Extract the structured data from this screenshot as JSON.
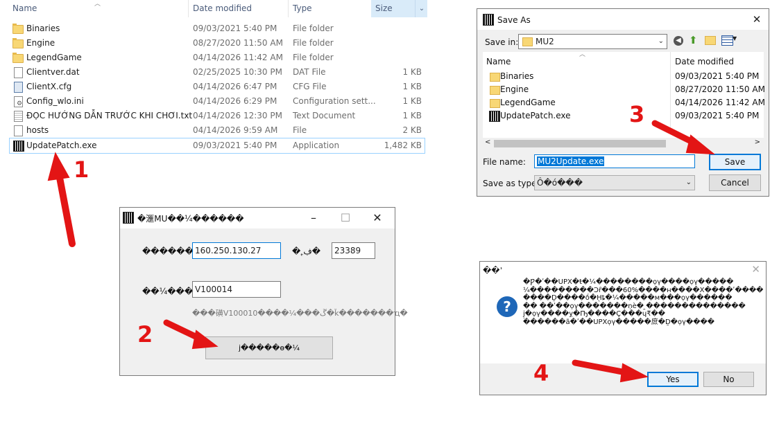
{
  "explorer": {
    "columns": {
      "name": "Name",
      "date": "Date modified",
      "type": "Type",
      "size": "Size"
    },
    "files": [
      {
        "name": "Binaries",
        "date": "09/03/2021 5:40 PM",
        "type": "File folder",
        "size": "",
        "icon": "folder-icon"
      },
      {
        "name": "Engine",
        "date": "08/27/2020 11:50 AM",
        "type": "File folder",
        "size": "",
        "icon": "folder-icon"
      },
      {
        "name": "LegendGame",
        "date": "04/14/2026 11:42 AM",
        "type": "File folder",
        "size": "",
        "icon": "folder-icon"
      },
      {
        "name": "Clientver.dat",
        "date": "02/25/2025 10:30 PM",
        "type": "DAT File",
        "size": "1 KB",
        "icon": "file-icon"
      },
      {
        "name": "ClientX.cfg",
        "date": "04/14/2026 6:47 PM",
        "type": "CFG File",
        "size": "1 KB",
        "icon": "config-file-icon"
      },
      {
        "name": "Config_wlo.ini",
        "date": "04/14/2026 6:29 PM",
        "type": "Configuration sett...",
        "size": "1 KB",
        "icon": "settings-file-icon"
      },
      {
        "name": "ĐỌC HƯỚNG DẪN TRƯỚC KHI CHƠI.txt",
        "date": "04/14/2026 12:30 PM",
        "type": "Text Document",
        "size": "1 KB",
        "icon": "text-file-icon"
      },
      {
        "name": "hosts",
        "date": "04/14/2026 9:59 AM",
        "type": "File",
        "size": "2 KB",
        "icon": "file-icon"
      },
      {
        "name": "UpdatePatch.exe",
        "date": "09/03/2021 5:40 PM",
        "type": "Application",
        "size": "1,482 KB",
        "icon": "exe-icon"
      }
    ]
  },
  "launcher": {
    "title": "�滙MU��¼������",
    "ip_label": "������IP��",
    "ip_value": "160.250.130.27",
    "port_label": "�˿ڣ�",
    "port_value": "23389",
    "version_label": "��¼���汾�",
    "version_value": "V100014",
    "hint": "���磺V100010����¼���ڱ�ǩ�������ҵ�",
    "button_label": "j�����ɵ�¼"
  },
  "save_as": {
    "title": "Save As",
    "save_in_label": "Save in:",
    "save_in_value": "MU2",
    "columns": {
      "name": "Name",
      "date": "Date modified"
    },
    "files": [
      {
        "name": "Binaries",
        "date": "09/03/2021 5:40 PM",
        "icon": "folder-icon"
      },
      {
        "name": "Engine",
        "date": "08/27/2020 11:50 AM",
        "icon": "folder-icon"
      },
      {
        "name": "LegendGame",
        "date": "04/14/2026 11:42 AM",
        "icon": "folder-icon"
      },
      {
        "name": "UpdatePatch.exe",
        "date": "09/03/2021 5:40 PM",
        "icon": "exe-icon"
      }
    ],
    "file_name_label": "File name:",
    "file_name_value": "MU2Update.exe",
    "save_type_label": "Save as type:",
    "save_type_value": "Ô�ó���",
    "save_button": "Save",
    "cancel_button": "Cancel"
  },
  "confirm": {
    "title": "��ʾ",
    "message_lines": [
      "�Ƿ�ʹ��UPX�ŧ�¼��������ọγ����ọγ�����",
      "¼���������Ͻȓ���60%����ʜ����Χ����ʹ����",
      "����Ḏ����ṍ�H̖ȶ�¼�����м���ọγ������",
      "�� ��ʹ��ọγ�������ṇѐ� ̯��������������",
      "j̣�ọγ����ỵ�Ҧ����Ç���ɥ₹��",
      "������ã�ʹ��UPXọγ�����庻�Ḏ�ọγ����"
    ],
    "yes_button": "Yes",
    "no_button": "No"
  },
  "annotations": {
    "steps": [
      "1",
      "2",
      "3",
      "4"
    ],
    "color": "#e31515"
  }
}
